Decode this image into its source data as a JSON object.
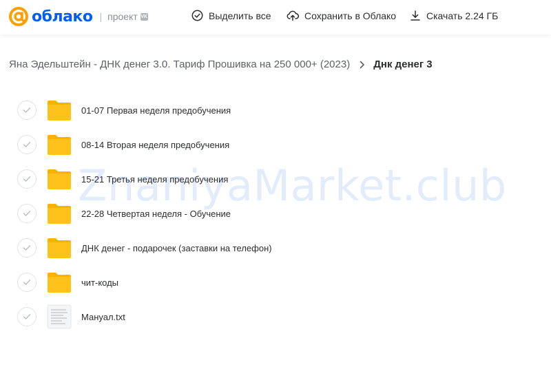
{
  "header": {
    "brand": "облако",
    "separator": "|",
    "subtitle": "проект",
    "actions": {
      "select_all": "Выделить все",
      "save": "Сохранить в Облако",
      "download": "Скачать 2.24 ГБ"
    }
  },
  "breadcrumb": {
    "parent": "Яна Эдельштейн - ДНК денег 3.0. Тариф Прошивка на 250 000+ (2023)",
    "current": "Днк денег 3"
  },
  "items": [
    {
      "name": "01-07 Первая неделя предобучения",
      "type": "folder"
    },
    {
      "name": "08-14 Вторая неделя предобучения",
      "type": "folder"
    },
    {
      "name": "15-21 Третья неделя предобучения",
      "type": "folder"
    },
    {
      "name": "22-28 Четвертая неделя - Обучение",
      "type": "folder"
    },
    {
      "name": "ДНК денег - подарочек (заставки на телефон)",
      "type": "folder"
    },
    {
      "name": "чит-коды",
      "type": "folder"
    },
    {
      "name": "Мануал.txt",
      "type": "file"
    }
  ],
  "watermark": "ZnaniyaMarket.club",
  "colors": {
    "brand": "#005ff9",
    "folder": "#ffc21a",
    "folder_back": "#ffb000",
    "text": "#2c2d2e",
    "muted": "#8c8f94"
  },
  "icons": {
    "logo": "at-sign-icon",
    "select_all": "check-circle-icon",
    "save": "cloud-upload-icon",
    "download": "download-icon",
    "breadcrumb_sep": "chevron-right-icon",
    "row_check": "check-icon",
    "folder": "folder-icon",
    "file": "text-file-icon"
  }
}
